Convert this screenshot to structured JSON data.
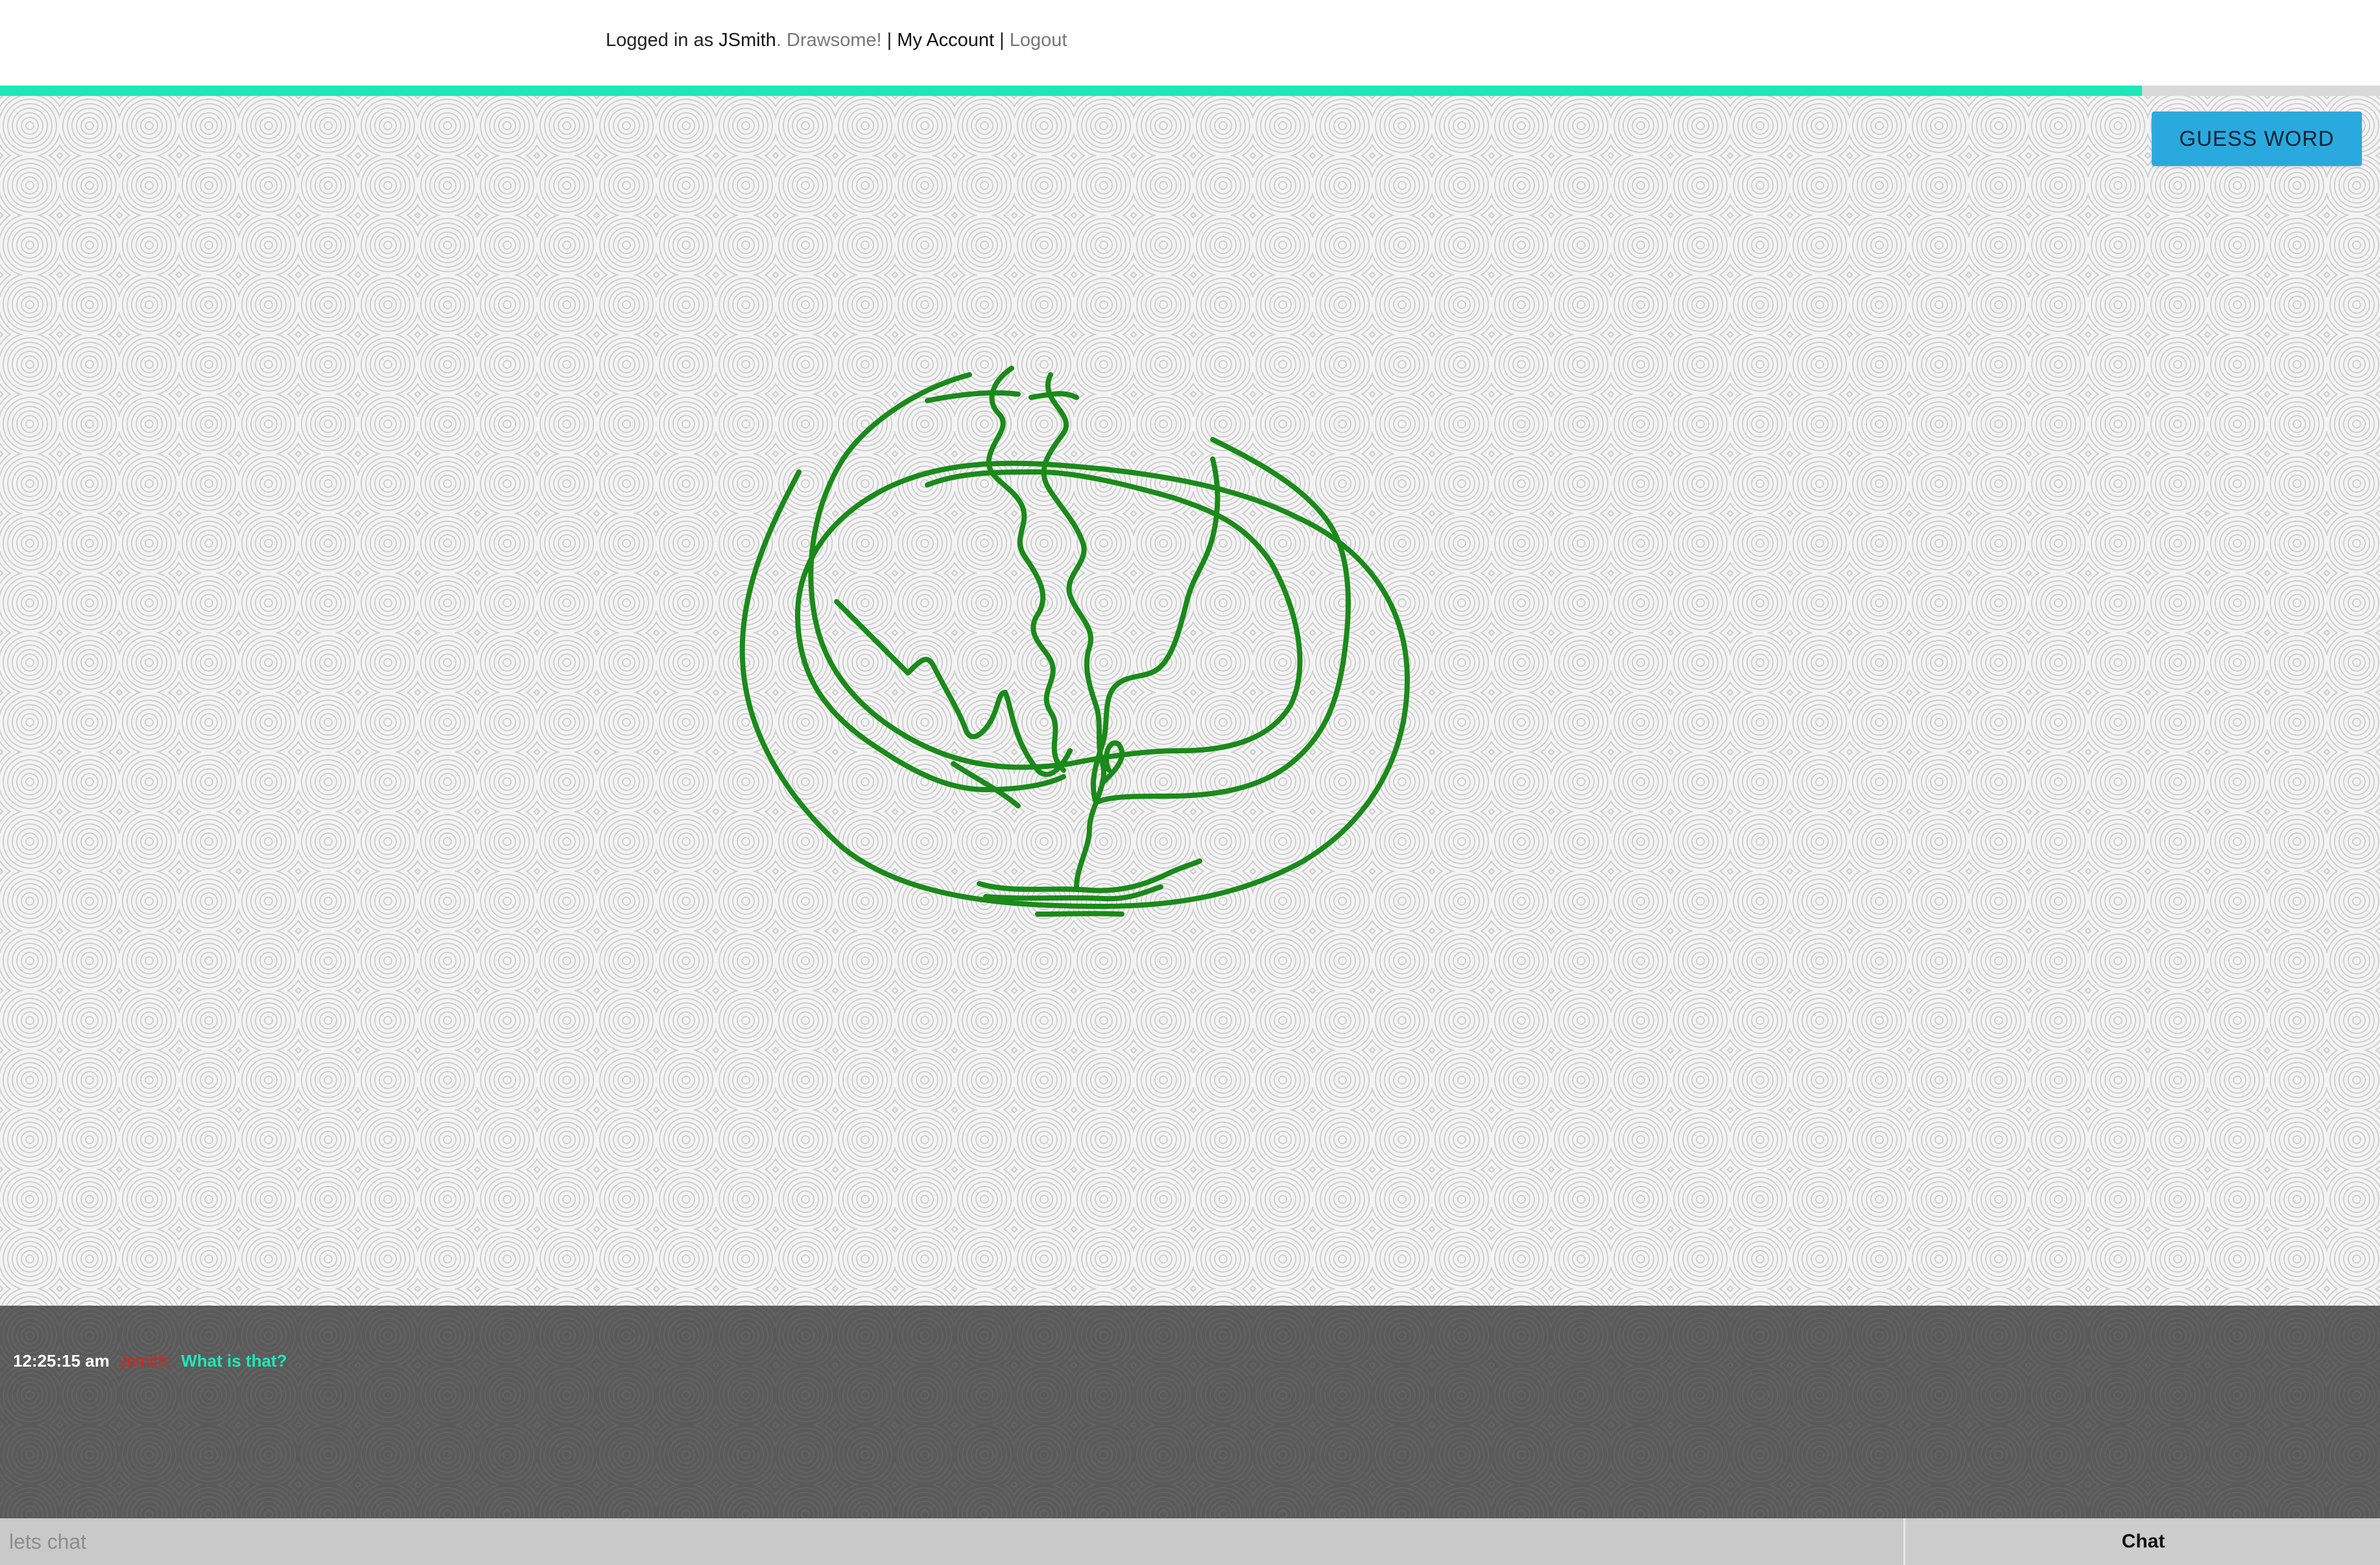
{
  "header": {
    "logged_in_prefix": "Logged in as ",
    "username": "JSmith",
    "tagline": ". Drawsome!",
    "separator_1": " | ",
    "my_account_label": "My Account",
    "separator_2": " | ",
    "logout_label": "Logout"
  },
  "progress": {
    "fraction": 0.9,
    "color": "#1de9b6"
  },
  "guess_button": {
    "label": "GUESS WORD",
    "color": "#2aa9df"
  },
  "drawing": {
    "stroke_color": "#1a8a1a"
  },
  "chat": {
    "messages": [
      {
        "time": "12:25:15 am",
        "author": "Jsmith:",
        "text": "What is that?"
      }
    ],
    "input_placeholder": "lets chat",
    "send_label": "Chat"
  }
}
